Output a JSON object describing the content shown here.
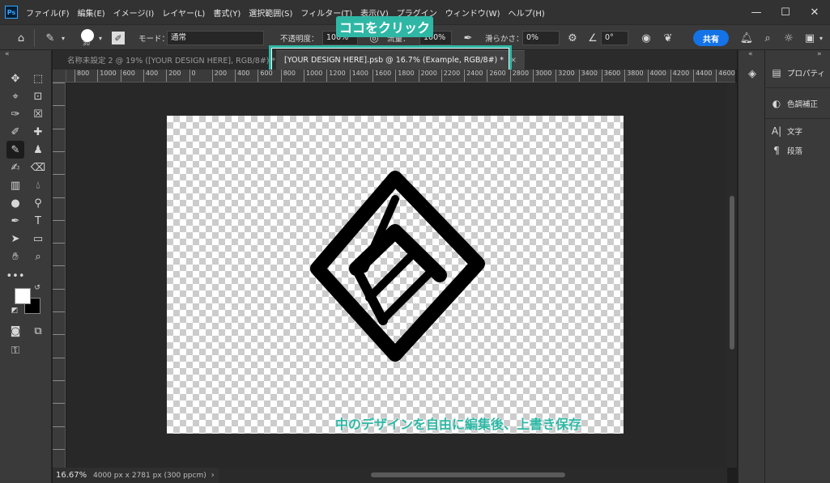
{
  "app": {
    "logo_text": "Ps"
  },
  "menu": [
    "ファイル(F)",
    "編集(E)",
    "イメージ(I)",
    "レイヤー(L)",
    "書式(Y)",
    "選択範囲(S)",
    "フィルター(T)",
    "表示(V)",
    "プラグイン",
    "ウィンドウ(W)",
    "ヘルプ(H)"
  ],
  "window_controls": {
    "minimize": "—",
    "maximize": "☐",
    "close": "✕"
  },
  "options": {
    "brush_size": "30",
    "mode_label": "モード：",
    "mode_value": "通常",
    "opacity_label": "不透明度：",
    "opacity_value": "100%",
    "flow_label": "流量：",
    "flow_value": "100%",
    "smoothing_label": "滑らかさ：",
    "smoothing_value": "0%",
    "angle_value": "0°",
    "share_label": "共有"
  },
  "tabs": [
    {
      "label": "名称未設定 2 @ 19% ([YOUR DESIGN HERE], RGB/8#) *",
      "active": false
    },
    {
      "label": "[YOUR DESIGN HERE].psb @ 16.7% (Example, RGB/8#) *",
      "active": true,
      "close": "×"
    }
  ],
  "ruler_labels": [
    "800",
    "1000",
    "600",
    "400",
    "200",
    "0",
    "200",
    "400",
    "600",
    "800",
    "1000",
    "1200",
    "1400",
    "1600",
    "1800",
    "2000",
    "2200",
    "2400",
    "2600",
    "2800",
    "3000",
    "3200",
    "3400",
    "3600",
    "3800",
    "4000",
    "4200",
    "4400",
    "4600",
    "4800"
  ],
  "annotations": {
    "click_here": "ココをクリック",
    "edit_instruction": "中のデザインを自由に編集後、上書き保存"
  },
  "status": {
    "zoom": "16.67%",
    "doc_info": "4000 px x 2781 px (300 ppcm)",
    "arrow": "›"
  },
  "panels": {
    "properties": "プロパティ",
    "adjustments": "色調補正",
    "character": "文字",
    "paragraph": "段落"
  },
  "colors": {
    "accent_teal": "#2fb7a5",
    "share_blue": "#1473e6",
    "foreground": "#ffffff",
    "background": "#000000"
  }
}
